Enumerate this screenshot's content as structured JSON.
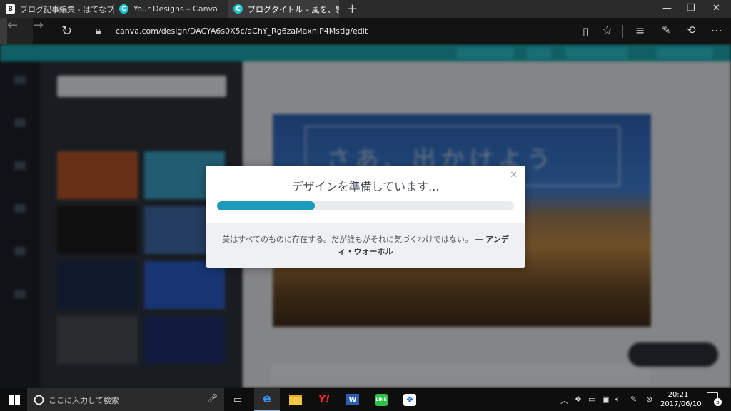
{
  "browser": {
    "tabs": [
      {
        "title": "ブログ記事編集 - はてなブログ",
        "favicon": "hatena-icon"
      },
      {
        "title": "Your Designs – Canva",
        "favicon": "canva-icon"
      },
      {
        "title": "ブログタイトル – 風を、感じ",
        "favicon": "canva-icon",
        "active": true
      }
    ],
    "url": "canva.com/design/DACYA6s0X5c/aChY_Rg6zaMaxnIP4Mstig/edit"
  },
  "canvas": {
    "heading": "さあ、出かけよう"
  },
  "modal": {
    "title": "デザインを準備しています...",
    "progress": 0.33,
    "progress_color": "#1c9bbd",
    "quote": "美はすべてのものに存在する。だが誰もがそれに気づくわけではない。",
    "attribution": "— アンディ・ウォーホル"
  },
  "taskbar": {
    "search_placeholder": "ここに入力して検索",
    "time": "20:21",
    "date": "2017/06/10",
    "notifications": "5"
  },
  "colors": {
    "canva_teal": "#1aa5ae",
    "panel_dark": "#2b323c"
  }
}
